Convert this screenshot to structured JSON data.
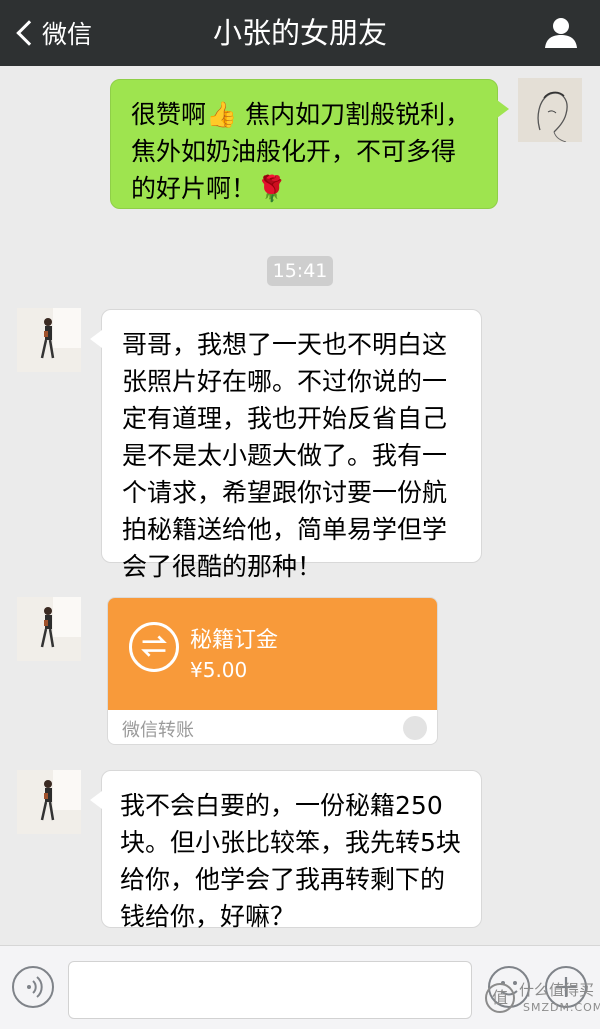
{
  "header": {
    "back_label": "微信",
    "title": "小张的女朋友"
  },
  "messages": [
    {
      "sender": "self",
      "text_line1": "很赞啊👍 焦内如刀割般锐利，",
      "text_line2": "焦外如奶油般化开，不可多得",
      "text_line3": "的好片啊！🌹"
    },
    {
      "type": "time",
      "text": "15:41"
    },
    {
      "sender": "girlfriend",
      "lines": [
        "哥哥，我想了一天也不明白这",
        "张照片好在哪。不过你说的一",
        "定有道理，我也开始反省自己",
        "是不是太小题大做了。我有一",
        "个请求，希望跟你讨要一份航",
        "拍秘籍送给他，简单易学但学",
        "会了很酷的那种！"
      ]
    },
    {
      "sender": "girlfriend",
      "type": "transfer",
      "title": "秘籍订金",
      "amount": "¥5.00",
      "caption": "微信转账"
    },
    {
      "sender": "girlfriend",
      "lines": [
        "我不会白要的，一份秘籍250",
        "块。但小张比较笨，我先转5块",
        "给你，他学会了我再转剩下的",
        "钱给你，好嘛？"
      ]
    }
  ],
  "input": {
    "placeholder": ""
  },
  "watermark": {
    "logo_char": "值",
    "text": "什么值得买",
    "domain": "SMZDM.COM"
  },
  "colors": {
    "header_bg": "#2e3132",
    "self_bubble": "#9ee44f",
    "transfer": "#f89a3a",
    "chat_bg": "#ebebeb"
  }
}
